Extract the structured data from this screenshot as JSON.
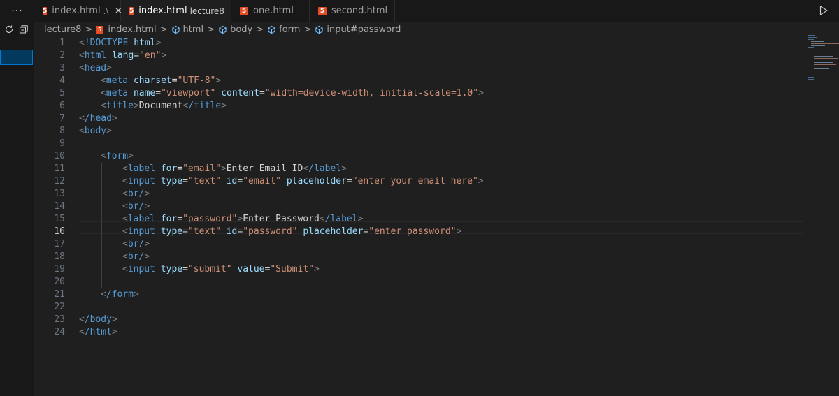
{
  "window": {
    "more_menu": "···"
  },
  "tabs": [
    {
      "name": "index.html",
      "desc": ".\\",
      "active": false,
      "close": "✕"
    },
    {
      "name": "index.html",
      "desc": "lecture8",
      "active": true,
      "close": "✕"
    },
    {
      "name": "one.html",
      "desc": "",
      "active": false
    },
    {
      "name": "second.html",
      "desc": "",
      "active": false
    }
  ],
  "breadcrumb": [
    "lecture8",
    "index.html",
    "html",
    "body",
    "form",
    "input#password"
  ],
  "editor": {
    "active_line": 16,
    "line_numbers": [
      "1",
      "2",
      "3",
      "4",
      "5",
      "6",
      "7",
      "8",
      "9",
      "10",
      "11",
      "12",
      "13",
      "14",
      "15",
      "16",
      "17",
      "18",
      "19",
      "20",
      "21",
      "22",
      "23",
      "24"
    ],
    "code": {
      "l1": {
        "doctype": "!DOCTYPE",
        "name": "html"
      },
      "l2": {
        "tag": "html",
        "attr": "lang",
        "val": "\"en\""
      },
      "l3": {
        "tag": "head"
      },
      "l4": {
        "tag": "meta",
        "attr": "charset",
        "val": "\"UTF-8\""
      },
      "l5": {
        "tag": "meta",
        "attr1": "name",
        "val1": "\"viewport\"",
        "attr2": "content",
        "val2": "\"width=device-width, initial-scale=1.0\""
      },
      "l6": {
        "tag": "title",
        "text": "Document",
        "close": "/title"
      },
      "l7": {
        "tag": "/head"
      },
      "l8": {
        "tag": "body"
      },
      "l10": {
        "tag": "form"
      },
      "l11": {
        "tag": "label",
        "attr": "for",
        "val": "\"email\"",
        "text": "Enter Email ID",
        "close": "/label"
      },
      "l12": {
        "tag": "input",
        "attr1": "type",
        "val1": "\"text\"",
        "attr2": "id",
        "val2": "\"email\"",
        "attr3": "placeholder",
        "val3": "\"enter your email here\""
      },
      "l13": {
        "tag": "br/"
      },
      "l14": {
        "tag": "br/"
      },
      "l15": {
        "tag": "label",
        "attr": "for",
        "val": "\"password\"",
        "text": "Enter Password",
        "close": "/label"
      },
      "l16": {
        "tag": "input",
        "attr1": "type",
        "val1": "\"text\"",
        "attr2": "id",
        "val2": "\"password\"",
        "attr3": "placeholder",
        "val3": "\"enter password\""
      },
      "l17": {
        "tag": "br/"
      },
      "l18": {
        "tag": "br/"
      },
      "l19": {
        "tag": "input",
        "attr1": "type",
        "val1": "\"submit\"",
        "attr2": "value",
        "val2": "\"Submit\""
      },
      "l21": {
        "tag": "/form"
      },
      "l23": {
        "tag": "/body"
      },
      "l24": {
        "tag": "/html"
      }
    }
  },
  "colors": {
    "background": "#1f1f1f",
    "tag": "#569cd6",
    "attribute": "#9cdcfe",
    "string": "#ce9178",
    "html5_badge": "#e44d26",
    "selection_accent": "#0078d4"
  },
  "icons": {
    "tab_file": "html5-icon",
    "run": "play-icon",
    "breadcrumb_symbol": "cube-icon",
    "refresh": "refresh-icon",
    "collapse": "collapse-all-icon"
  }
}
